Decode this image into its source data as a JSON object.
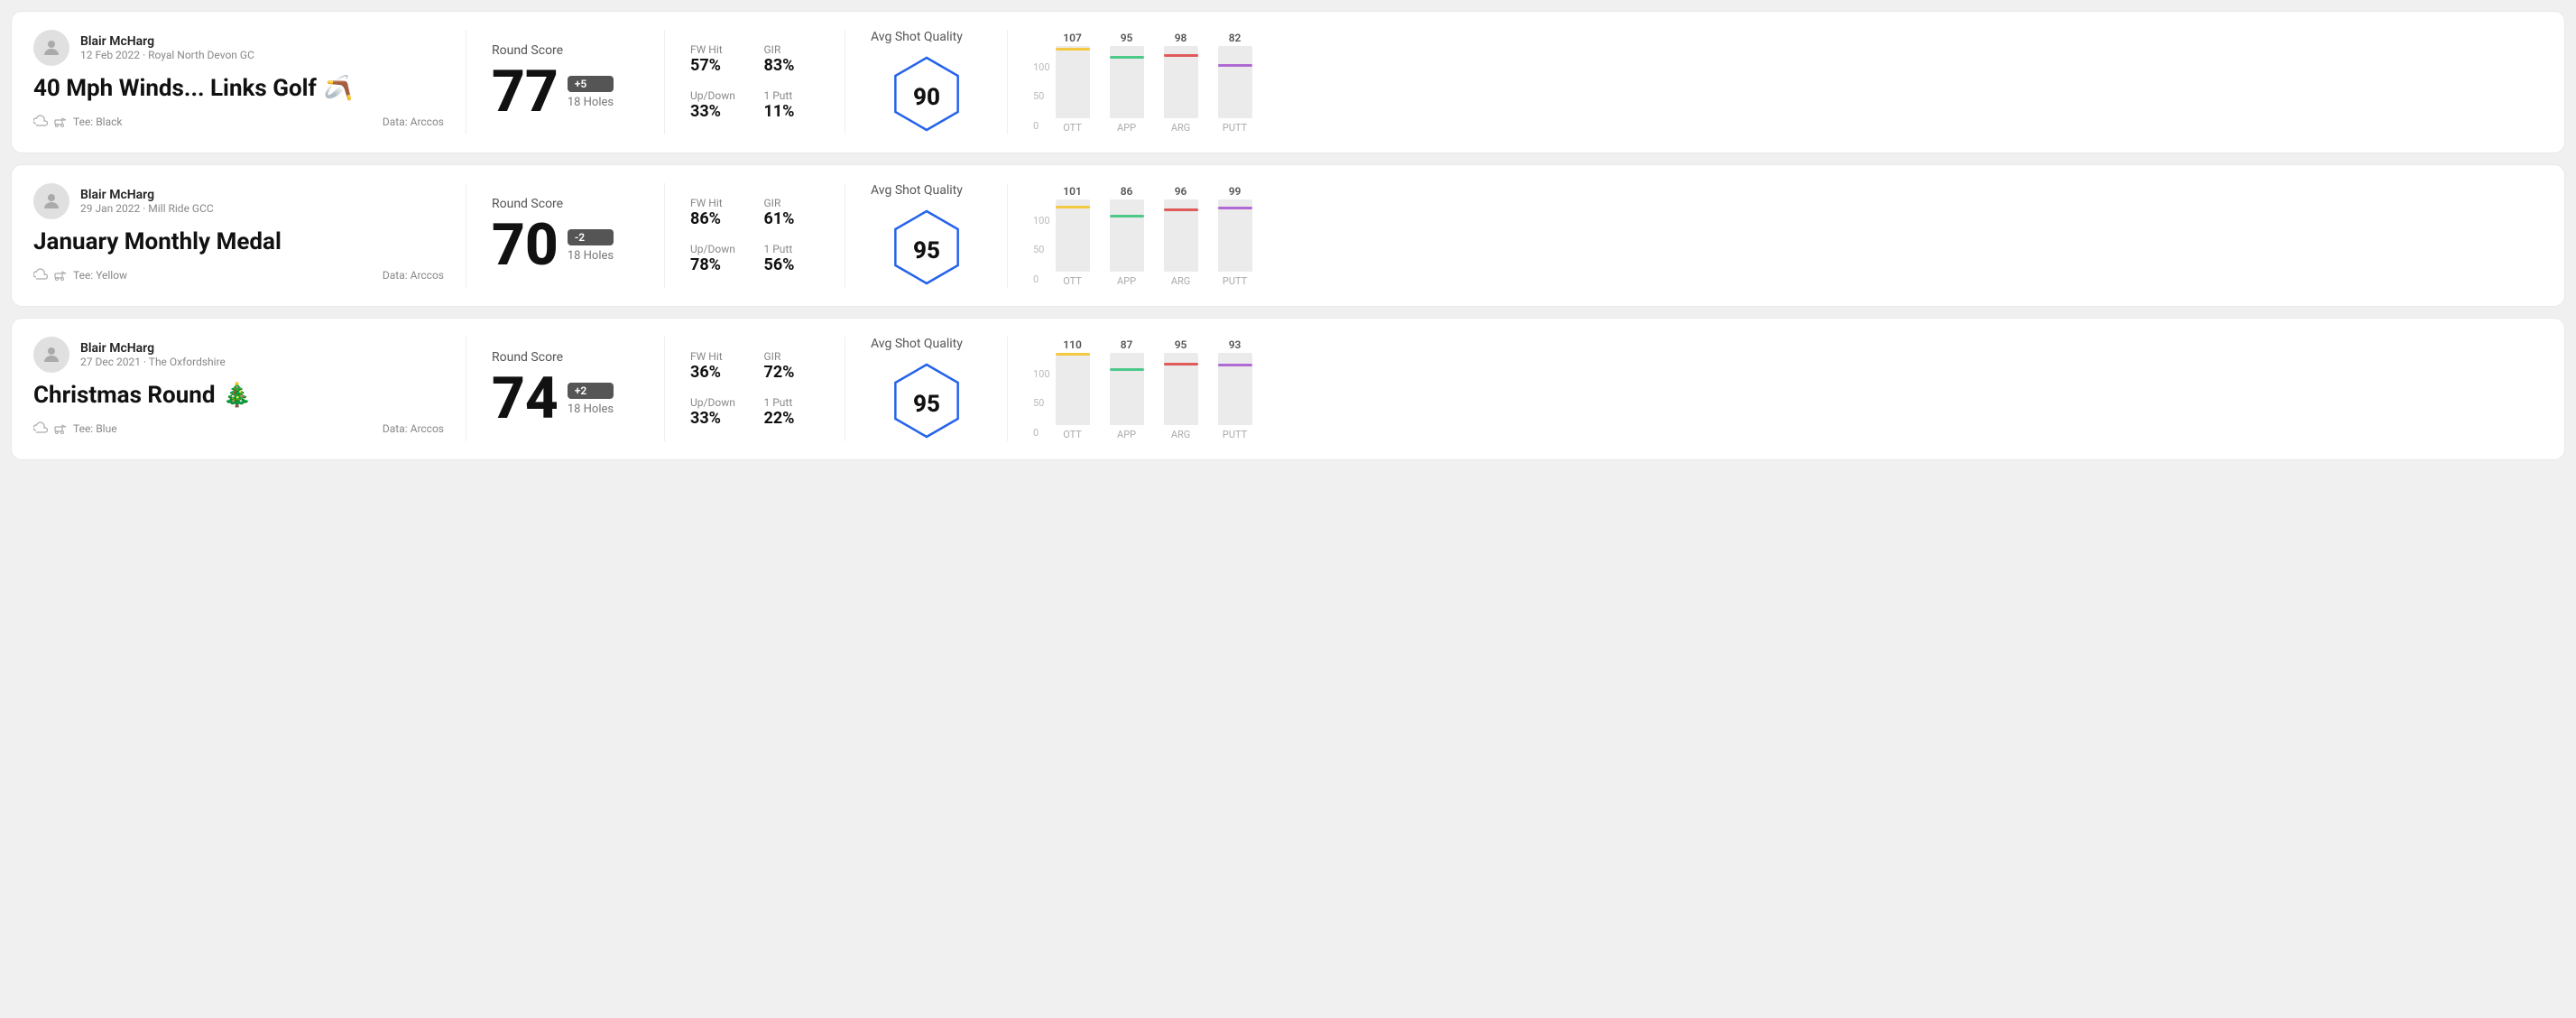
{
  "rounds": [
    {
      "id": "round1",
      "user": {
        "name": "Blair McHarg",
        "date": "12 Feb 2022 · Royal North Devon GC"
      },
      "title": "40 Mph Winds... Links Golf",
      "emoji": "🪃",
      "tee": "Black",
      "data_source": "Data: Arccos",
      "round_score_label": "Round Score",
      "score": "77",
      "score_diff": "+5",
      "holes": "18 Holes",
      "fw_hit_label": "FW Hit",
      "fw_hit": "57%",
      "gir_label": "GIR",
      "gir": "83%",
      "updown_label": "Up/Down",
      "updown": "33%",
      "oneputt_label": "1 Putt",
      "oneputt": "11%",
      "quality_label": "Avg Shot Quality",
      "quality_score": "90",
      "bars": [
        {
          "label": "OTT",
          "value": 107,
          "color": "#f5c842"
        },
        {
          "label": "APP",
          "value": 95,
          "color": "#4dc98a"
        },
        {
          "label": "ARG",
          "value": 98,
          "color": "#e05a5a"
        },
        {
          "label": "PUTT",
          "value": 82,
          "color": "#b06ad4"
        }
      ]
    },
    {
      "id": "round2",
      "user": {
        "name": "Blair McHarg",
        "date": "29 Jan 2022 · Mill Ride GCC"
      },
      "title": "January Monthly Medal",
      "emoji": "",
      "tee": "Yellow",
      "data_source": "Data: Arccos",
      "round_score_label": "Round Score",
      "score": "70",
      "score_diff": "-2",
      "holes": "18 Holes",
      "fw_hit_label": "FW Hit",
      "fw_hit": "86%",
      "gir_label": "GIR",
      "gir": "61%",
      "updown_label": "Up/Down",
      "updown": "78%",
      "oneputt_label": "1 Putt",
      "oneputt": "56%",
      "quality_label": "Avg Shot Quality",
      "quality_score": "95",
      "bars": [
        {
          "label": "OTT",
          "value": 101,
          "color": "#f5c842"
        },
        {
          "label": "APP",
          "value": 86,
          "color": "#4dc98a"
        },
        {
          "label": "ARG",
          "value": 96,
          "color": "#e05a5a"
        },
        {
          "label": "PUTT",
          "value": 99,
          "color": "#b06ad4"
        }
      ]
    },
    {
      "id": "round3",
      "user": {
        "name": "Blair McHarg",
        "date": "27 Dec 2021 · The Oxfordshire"
      },
      "title": "Christmas Round",
      "emoji": "🎄",
      "tee": "Blue",
      "data_source": "Data: Arccos",
      "round_score_label": "Round Score",
      "score": "74",
      "score_diff": "+2",
      "holes": "18 Holes",
      "fw_hit_label": "FW Hit",
      "fw_hit": "36%",
      "gir_label": "GIR",
      "gir": "72%",
      "updown_label": "Up/Down",
      "updown": "33%",
      "oneputt_label": "1 Putt",
      "oneputt": "22%",
      "quality_label": "Avg Shot Quality",
      "quality_score": "95",
      "bars": [
        {
          "label": "OTT",
          "value": 110,
          "color": "#f5c842"
        },
        {
          "label": "APP",
          "value": 87,
          "color": "#4dc98a"
        },
        {
          "label": "ARG",
          "value": 95,
          "color": "#e05a5a"
        },
        {
          "label": "PUTT",
          "value": 93,
          "color": "#b06ad4"
        }
      ]
    }
  ]
}
